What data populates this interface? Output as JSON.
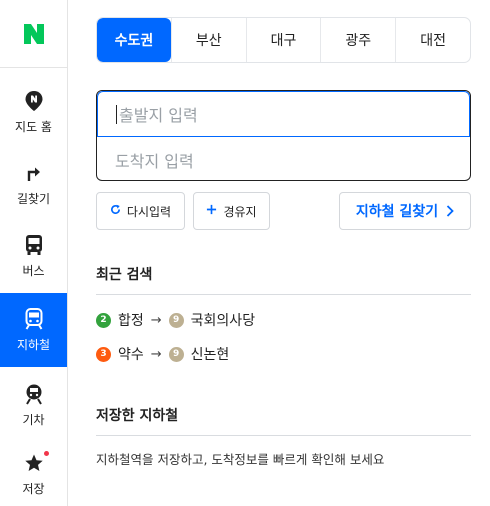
{
  "sidebar": {
    "items": [
      {
        "label": "지도 홈",
        "icon": "map-pin-n-icon"
      },
      {
        "label": "길찾기",
        "icon": "turn-right-arrow-icon"
      },
      {
        "label": "버스",
        "icon": "bus-icon"
      },
      {
        "label": "지하철",
        "icon": "subway-icon",
        "active": true
      },
      {
        "label": "기차",
        "icon": "train-icon"
      },
      {
        "label": "저장",
        "icon": "star-icon",
        "notification_dot": true
      }
    ]
  },
  "region_tabs": [
    "수도권",
    "부산",
    "대구",
    "광주",
    "대전"
  ],
  "active_region": "수도권",
  "search": {
    "origin_placeholder": "출발지 입력",
    "destination_placeholder": "도착지 입력"
  },
  "buttons": {
    "reset": "다시입력",
    "waypoint": "경유지",
    "find_route": "지하철 길찾기"
  },
  "recent": {
    "title": "최근 검색",
    "items": [
      {
        "from": {
          "line": "2",
          "station": "합정",
          "color": "#33a23d"
        },
        "to": {
          "line": "9",
          "station": "국회의사당",
          "color": "#bdb092"
        }
      },
      {
        "from": {
          "line": "3",
          "station": "약수",
          "color": "#fe5b10"
        },
        "to": {
          "line": "9",
          "station": "신논현",
          "color": "#bdb092"
        }
      }
    ]
  },
  "saved": {
    "title": "저장한 지하철",
    "description": "지하철역을 저장하고, 도착정보를 빠르게 확인해 보세요"
  },
  "colors": {
    "accent": "#0068ff",
    "brand": "#03c75a",
    "line9": "#bdb092"
  }
}
